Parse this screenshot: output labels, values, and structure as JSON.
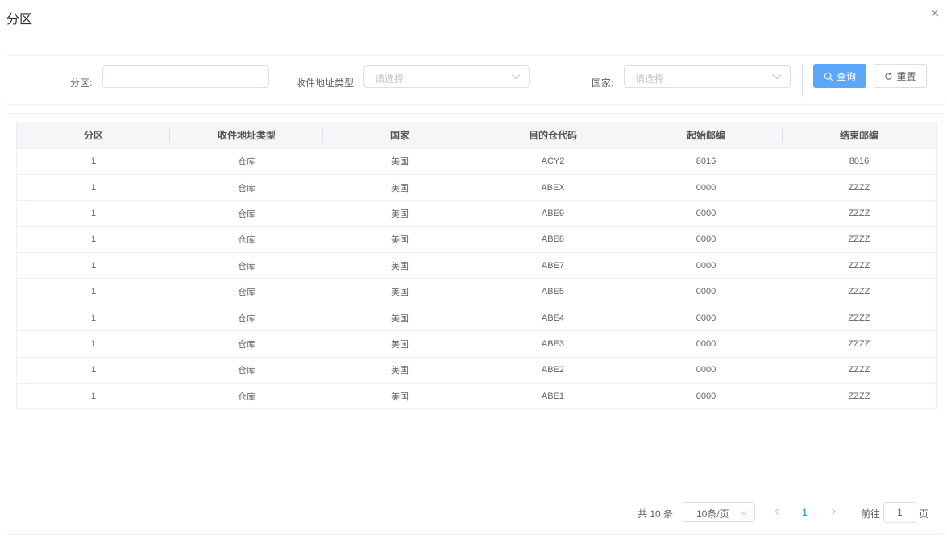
{
  "dialog": {
    "title": "分区",
    "close_icon": "close-icon"
  },
  "search": {
    "partition_label": "分区:",
    "partition_value": "",
    "address_type_label": "收件地址类型:",
    "address_type_placeholder": "请选择",
    "country_label": "国家:",
    "country_placeholder": "请选择",
    "query_button": "查询",
    "reset_button": "重置",
    "accent_color": "#5ba6f8"
  },
  "table": {
    "columns": [
      "分区",
      "收件地址类型",
      "国家",
      "目的仓代码",
      "起始邮编",
      "结束邮编"
    ],
    "rows": [
      [
        "1",
        "仓库",
        "美国",
        "ACY2",
        "8016",
        "8016"
      ],
      [
        "1",
        "仓库",
        "美国",
        "ABEX",
        "0000",
        "ZZZZ"
      ],
      [
        "1",
        "仓库",
        "美国",
        "ABE9",
        "0000",
        "ZZZZ"
      ],
      [
        "1",
        "仓库",
        "美国",
        "ABE8",
        "0000",
        "ZZZZ"
      ],
      [
        "1",
        "仓库",
        "美国",
        "ABE7",
        "0000",
        "ZZZZ"
      ],
      [
        "1",
        "仓库",
        "美国",
        "ABE5",
        "0000",
        "ZZZZ"
      ],
      [
        "1",
        "仓库",
        "美国",
        "ABE4",
        "0000",
        "ZZZZ"
      ],
      [
        "1",
        "仓库",
        "美国",
        "ABE3",
        "0000",
        "ZZZZ"
      ],
      [
        "1",
        "仓库",
        "美国",
        "ABE2",
        "0000",
        "ZZZZ"
      ],
      [
        "1",
        "仓库",
        "美国",
        "ABE1",
        "0000",
        "ZZZZ"
      ]
    ]
  },
  "pagination": {
    "total": "共 10 条",
    "page_size": "10条/页",
    "current_page": "1",
    "goto_label": "前往",
    "goto_value": "1",
    "page_unit": "页"
  }
}
